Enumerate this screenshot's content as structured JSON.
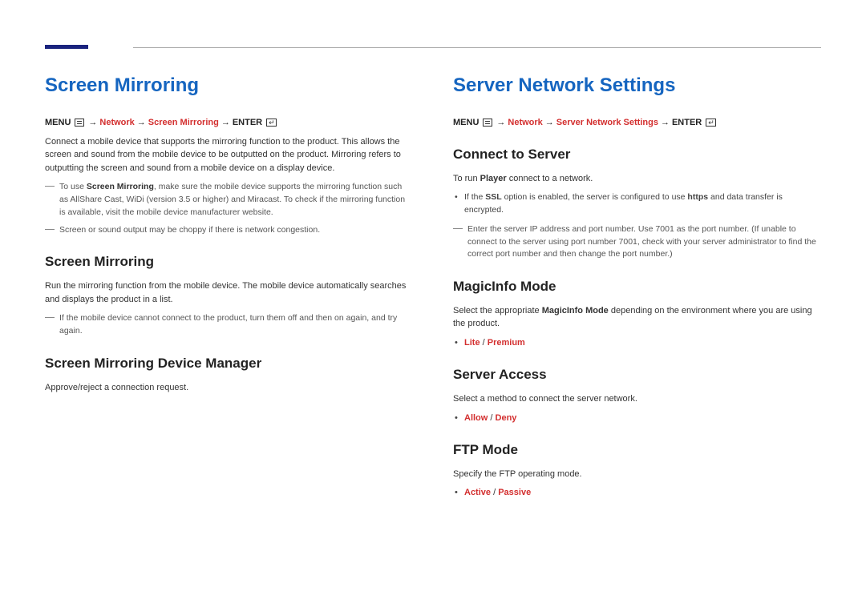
{
  "left": {
    "title": "Screen Mirroring",
    "breadcrumb": {
      "menu": "MENU",
      "s1": "Network",
      "s2": "Screen Mirroring",
      "enter": "ENTER"
    },
    "intro": "Connect a mobile device that supports the mirroring function to the product. This allows the screen and sound from the mobile device to be outputted on the product. Mirroring refers to outputting the screen and sound from a mobile device on a display device.",
    "note1_pre": "To use ",
    "note1_bold": "Screen Mirroring",
    "note1_post": ", make sure the mobile device supports the mirroring function such as AllShare Cast, WiDi (version 3.5 or higher) and Miracast. To check if the mirroring function is available, visit the mobile device manufacturer website.",
    "note2": "Screen or sound output may be choppy if there is network congestion.",
    "h2a": "Screen Mirroring",
    "p2": "Run the mirroring function from the mobile device. The mobile device automatically searches and displays the product in a list.",
    "note3": "If the mobile device cannot connect to the product, turn them off and then on again, and try again.",
    "h2b": "Screen Mirroring Device Manager",
    "p3": "Approve/reject a connection request."
  },
  "right": {
    "title": "Server Network Settings",
    "breadcrumb": {
      "menu": "MENU",
      "s1": "Network",
      "s2": "Server Network Settings",
      "enter": "ENTER"
    },
    "h2a": "Connect to Server",
    "p1_pre": "To run ",
    "p1_bold": "Player",
    "p1_post": " connect to a network.",
    "bullet1_pre": "If the ",
    "bullet1_bold1": "SSL",
    "bullet1_mid": " option is enabled, the server is configured to use ",
    "bullet1_bold2": "https",
    "bullet1_post": " and data transfer is encrypted.",
    "note1": "Enter the server IP address and port number. Use 7001 as the port number. (If unable to connect to the server using port number 7001, check with your server administrator to find the correct port number and then change the port number.)",
    "h2b": "MagicInfo Mode",
    "p2_pre": "Select the appropriate ",
    "p2_bold": "MagicInfo Mode",
    "p2_post": " depending on the environment where you are using the product.",
    "opt_b": {
      "a": "Lite",
      "sep": "/",
      "b": "Premium"
    },
    "h2c": "Server Access",
    "p3": "Select a method to connect the server network.",
    "opt_c": {
      "a": "Allow",
      "sep": "/",
      "b": "Deny"
    },
    "h2d": "FTP Mode",
    "p4": "Specify the FTP operating mode.",
    "opt_d": {
      "a": "Active",
      "sep": "/",
      "b": "Passive"
    }
  }
}
